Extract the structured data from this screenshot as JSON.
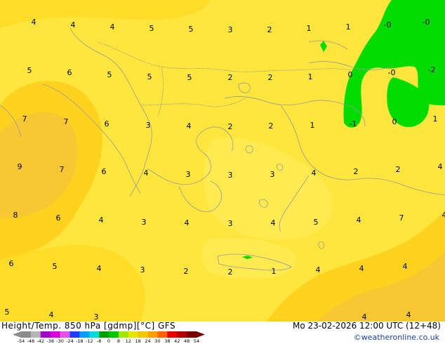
{
  "header": {
    "title": "Height/Temp. 850 hPa [gdmp][°C] GFS",
    "datetime": "Mo 23-02-2026 12:00 UTC (12+48)",
    "credit": "©weatheronline.co.uk"
  },
  "legend": {
    "ticks": [
      "-54",
      "-48",
      "-42",
      "-38",
      "-30",
      "-24",
      "-18",
      "-12",
      "-8",
      "0",
      "8",
      "12",
      "18",
      "24",
      "30",
      "38",
      "42",
      "48",
      "54"
    ],
    "colors": [
      "#8c8c8c",
      "#b4b4b4",
      "#a000c8",
      "#dc00dc",
      "#e650e6",
      "#1e3cff",
      "#00a0ff",
      "#00dcdc",
      "#00a000",
      "#00c800",
      "#a0e600",
      "#e6e600",
      "#f0c800",
      "#ffa000",
      "#ff6400",
      "#e60000",
      "#b40000",
      "#780000"
    ]
  },
  "colors": {
    "base": "#FFE63C",
    "warm": "#FFD21E",
    "warmer": "#F5C832",
    "cold": "#00DC00"
  },
  "labels": [
    {
      "text": "4",
      "gx": 48,
      "gy": 35
    },
    {
      "text": "4",
      "gx": 104,
      "gy": 39
    },
    {
      "text": "4",
      "gx": 160,
      "gy": 42
    },
    {
      "text": "5",
      "gx": 216,
      "gy": 44
    },
    {
      "text": "5",
      "gx": 272,
      "gy": 45
    },
    {
      "text": "3",
      "gx": 328,
      "gy": 46
    },
    {
      "text": "2",
      "gx": 384,
      "gy": 46
    },
    {
      "text": "1",
      "gx": 440,
      "gy": 44
    },
    {
      "text": "1",
      "gx": 496,
      "gy": 42
    },
    {
      "text": "-0",
      "gx": 552,
      "gy": 39
    },
    {
      "text": "-0",
      "gx": 607,
      "gy": 35
    },
    {
      "text": "5",
      "gx": 42,
      "gy": 104
    },
    {
      "text": "6",
      "gx": 99,
      "gy": 107
    },
    {
      "text": "5",
      "gx": 156,
      "gy": 110
    },
    {
      "text": "5",
      "gx": 213,
      "gy": 113
    },
    {
      "text": "5",
      "gx": 270,
      "gy": 114
    },
    {
      "text": "2",
      "gx": 328,
      "gy": 114
    },
    {
      "text": "2",
      "gx": 385,
      "gy": 114
    },
    {
      "text": "1",
      "gx": 442,
      "gy": 113
    },
    {
      "text": "0",
      "gx": 499,
      "gy": 110
    },
    {
      "text": "-0",
      "gx": 558,
      "gy": 107
    },
    {
      "text": "-2",
      "gx": 615,
      "gy": 103
    },
    {
      "text": "7",
      "gx": 35,
      "gy": 173
    },
    {
      "text": "7",
      "gx": 94,
      "gy": 177
    },
    {
      "text": "6",
      "gx": 152,
      "gy": 180
    },
    {
      "text": "3",
      "gx": 211,
      "gy": 182
    },
    {
      "text": "4",
      "gx": 269,
      "gy": 183
    },
    {
      "text": "2",
      "gx": 328,
      "gy": 184
    },
    {
      "text": "2",
      "gx": 386,
      "gy": 183
    },
    {
      "text": "1",
      "gx": 445,
      "gy": 182
    },
    {
      "text": "-1",
      "gx": 503,
      "gy": 180
    },
    {
      "text": "0",
      "gx": 562,
      "gy": 177
    },
    {
      "text": "1",
      "gx": 620,
      "gy": 173
    },
    {
      "text": "9",
      "gx": 28,
      "gy": 241
    },
    {
      "text": "7",
      "gx": 88,
      "gy": 245
    },
    {
      "text": "6",
      "gx": 148,
      "gy": 248
    },
    {
      "text": "4",
      "gx": 208,
      "gy": 250
    },
    {
      "text": "3",
      "gx": 268,
      "gy": 252
    },
    {
      "text": "3",
      "gx": 328,
      "gy": 253
    },
    {
      "text": "3",
      "gx": 388,
      "gy": 252
    },
    {
      "text": "4",
      "gx": 447,
      "gy": 250
    },
    {
      "text": "2",
      "gx": 507,
      "gy": 248
    },
    {
      "text": "2",
      "gx": 567,
      "gy": 245
    },
    {
      "text": "4",
      "gx": 627,
      "gy": 241
    },
    {
      "text": "8",
      "gx": 22,
      "gy": 310
    },
    {
      "text": "6",
      "gx": 83,
      "gy": 314
    },
    {
      "text": "4",
      "gx": 144,
      "gy": 317
    },
    {
      "text": "3",
      "gx": 205,
      "gy": 320
    },
    {
      "text": "4",
      "gx": 266,
      "gy": 321
    },
    {
      "text": "3",
      "gx": 328,
      "gy": 322
    },
    {
      "text": "4",
      "gx": 389,
      "gy": 321
    },
    {
      "text": "5",
      "gx": 450,
      "gy": 320
    },
    {
      "text": "4",
      "gx": 511,
      "gy": 317
    },
    {
      "text": "7",
      "gx": 572,
      "gy": 314
    },
    {
      "text": "4",
      "gx": 633,
      "gy": 310
    },
    {
      "text": "6",
      "gx": 16,
      "gy": 379
    },
    {
      "text": "5",
      "gx": 78,
      "gy": 383
    },
    {
      "text": "4",
      "gx": 141,
      "gy": 386
    },
    {
      "text": "3",
      "gx": 203,
      "gy": 388
    },
    {
      "text": "2",
      "gx": 265,
      "gy": 390
    },
    {
      "text": "2",
      "gx": 328,
      "gy": 391
    },
    {
      "text": "1",
      "gx": 390,
      "gy": 390
    },
    {
      "text": "4",
      "gx": 453,
      "gy": 388
    },
    {
      "text": "4",
      "gx": 515,
      "gy": 386
    },
    {
      "text": "4",
      "gx": 577,
      "gy": 383
    },
    {
      "text": "5",
      "gx": 10,
      "gy": 448
    },
    {
      "text": "4",
      "gx": 73,
      "gy": 452
    },
    {
      "text": "3",
      "gx": 137,
      "gy": 455
    },
    {
      "text": "4",
      "gx": 519,
      "gy": 455
    },
    {
      "text": "4",
      "gx": 582,
      "gy": 452
    }
  ]
}
